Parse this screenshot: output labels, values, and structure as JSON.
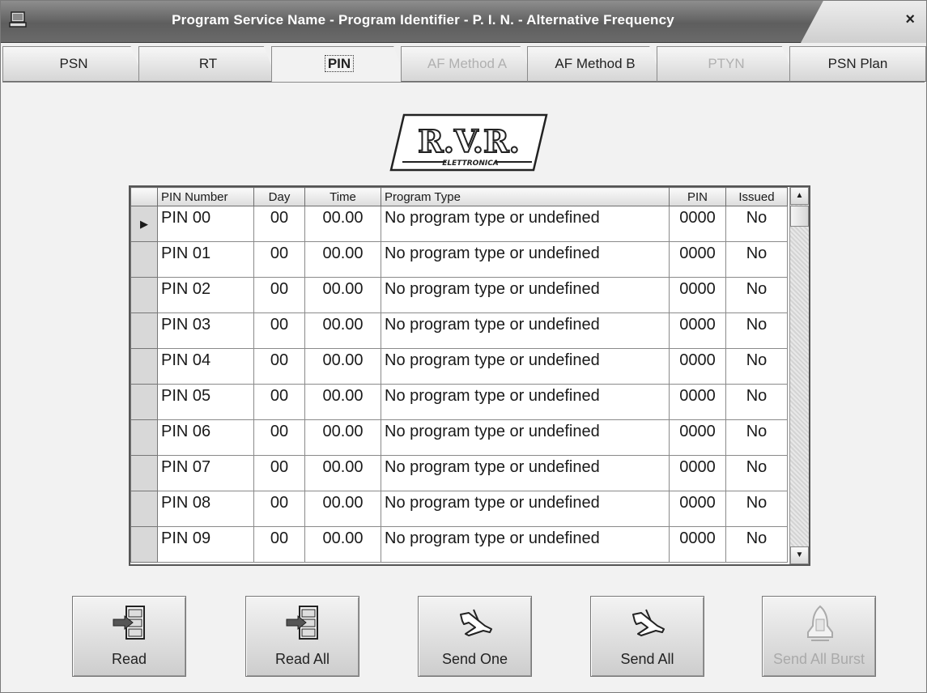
{
  "window": {
    "title": "Program Service Name - Program Identifier - P. I. N. - Alternative Frequency",
    "close_label": "×"
  },
  "tabs": [
    {
      "label": "PSN",
      "state": "normal"
    },
    {
      "label": "RT",
      "state": "normal"
    },
    {
      "label": "PIN",
      "state": "active"
    },
    {
      "label": "AF Method A",
      "state": "disabled"
    },
    {
      "label": "AF Method B",
      "state": "normal"
    },
    {
      "label": "PTYN",
      "state": "disabled"
    },
    {
      "label": "PSN Plan",
      "state": "normal"
    }
  ],
  "logo": {
    "text": "R.V.R.",
    "subtext": "ELETTRONICA"
  },
  "grid": {
    "columns": [
      "PIN Number",
      "Day",
      "Time",
      "Program Type",
      "PIN",
      "Issued"
    ],
    "rows": [
      [
        "PIN 00",
        "00",
        "00.00",
        "No program type or undefined",
        "0000",
        "No"
      ],
      [
        "PIN 01",
        "00",
        "00.00",
        "No program type or undefined",
        "0000",
        "No"
      ],
      [
        "PIN 02",
        "00",
        "00.00",
        "No program type or undefined",
        "0000",
        "No"
      ],
      [
        "PIN 03",
        "00",
        "00.00",
        "No program type or undefined",
        "0000",
        "No"
      ],
      [
        "PIN 04",
        "00",
        "00.00",
        "No program type or undefined",
        "0000",
        "No"
      ],
      [
        "PIN 05",
        "00",
        "00.00",
        "No program type or undefined",
        "0000",
        "No"
      ],
      [
        "PIN 06",
        "00",
        "00.00",
        "No program type or undefined",
        "0000",
        "No"
      ],
      [
        "PIN 07",
        "00",
        "00.00",
        "No program type or undefined",
        "0000",
        "No"
      ],
      [
        "PIN 08",
        "00",
        "00.00",
        "No program type or undefined",
        "0000",
        "No"
      ],
      [
        "PIN 09",
        "00",
        "00.00",
        "No program type or undefined",
        "0000",
        "No"
      ]
    ],
    "current_row_marker": "▶"
  },
  "buttons": [
    {
      "label": "Read",
      "icon": "file-cabinet-icon",
      "enabled": true
    },
    {
      "label": "Read All",
      "icon": "file-cabinet-icon",
      "enabled": true
    },
    {
      "label": "Send One",
      "icon": "airplane-icon",
      "enabled": true
    },
    {
      "label": "Send All",
      "icon": "airplane-icon",
      "enabled": true
    },
    {
      "label": "Send All Burst",
      "icon": "space-shuttle-icon",
      "enabled": false
    }
  ]
}
